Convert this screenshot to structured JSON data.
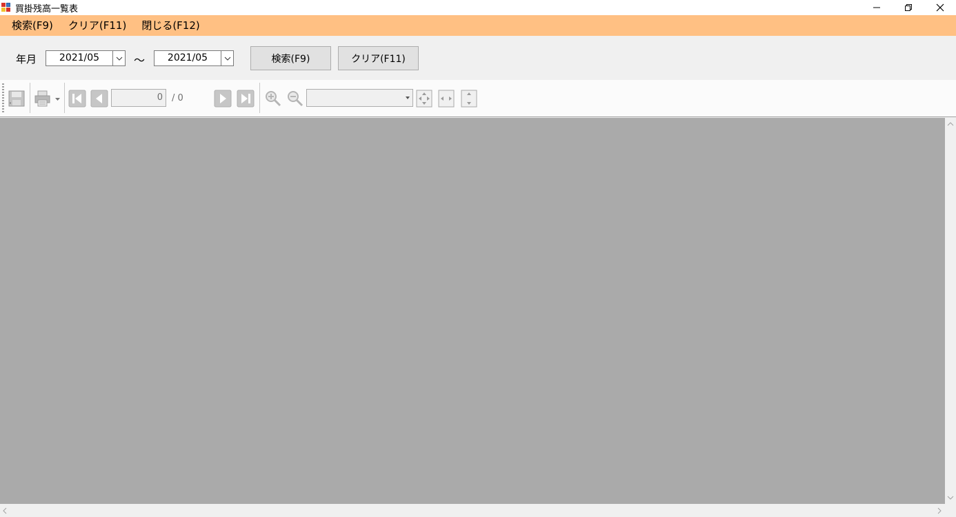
{
  "window": {
    "title": "買掛残高一覧表",
    "icon": "app-report-icon",
    "controls": [
      "minimize-icon",
      "restore-icon",
      "close-icon"
    ]
  },
  "colors": {
    "menubar": "#ffc083",
    "viewer_bg": "#aaaaaa",
    "panel_bg": "#f0f0f0"
  },
  "menu": {
    "items": [
      {
        "label": "検索(F9)"
      },
      {
        "label": "クリア(F11)"
      },
      {
        "label": "閉じる(F12)"
      }
    ]
  },
  "search": {
    "year_month_label": "年月",
    "from_value": "2021/05",
    "separator": "～",
    "to_value": "2021/05",
    "search_button": "検索(F9)",
    "clear_button": "クリア(F11)"
  },
  "viewer_toolbar": {
    "current_page": "0",
    "page_total": "/ 0",
    "zoom_value": "",
    "icons": [
      "save-icon",
      "print-icon",
      "first-page-icon",
      "prev-page-icon",
      "next-page-icon",
      "last-page-icon",
      "zoom-in-icon",
      "zoom-out-icon",
      "fit-page-icon",
      "fit-width-icon",
      "fit-height-icon"
    ]
  }
}
